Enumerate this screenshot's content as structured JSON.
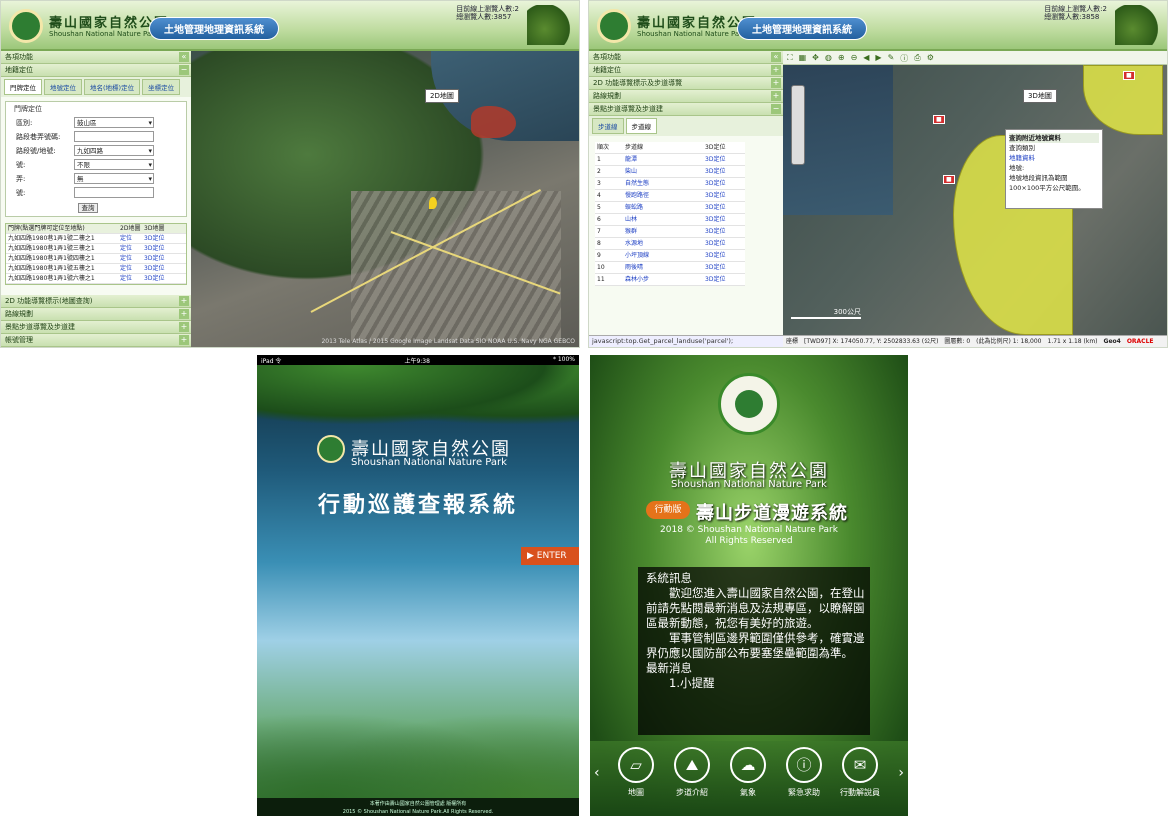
{
  "p1": {
    "header": {
      "title_cn": "壽山國家自然公園",
      "title_en": "Shoushan National Nature Park",
      "system": "土地管理地理資訊系統",
      "stat1": "目前線上瀏覽人數:2",
      "stat2": "總瀏覽人數:3857"
    },
    "sidebar": {
      "top": "各項功能",
      "section1": "地籍定位",
      "tabs": [
        "門牌定位",
        "地號定位",
        "地名(地標)定位",
        "坐標定位"
      ],
      "fieldset": "門牌定位",
      "fields": [
        {
          "label": "區別:",
          "value": "鼓山區"
        },
        {
          "label": "路段巷弄號碼:",
          "value": ""
        },
        {
          "label": "路段號/地號:",
          "value": "九如四路"
        },
        {
          "label": "號:",
          "value": "不限"
        },
        {
          "label": "弄:",
          "value": "無"
        },
        {
          "label": "號:",
          "value": ""
        }
      ],
      "query": "查詢",
      "table_head": [
        "門牌(點選門牌可定位至地點)",
        "2D地圖",
        "3D地圖"
      ],
      "rows": [
        {
          "addr": "九如四路1980巷1弄1號二樓之1",
          "a": "定位",
          "b": "3D定位"
        },
        {
          "addr": "九如四路1980巷1弄1號三樓之1",
          "a": "定位",
          "b": "3D定位"
        },
        {
          "addr": "九如四路1980巷1弄1號四樓之1",
          "a": "定位",
          "b": "3D定位"
        },
        {
          "addr": "九如四路1980巷1弄1號五樓之1",
          "a": "定位",
          "b": "3D定位"
        },
        {
          "addr": "九如四路1980巷1弄1號六樓之1",
          "a": "定位",
          "b": "3D定位"
        }
      ],
      "bottom": [
        "2D 功能導覽標示(地圖查詢)",
        "路線規劃",
        "景點步道導覽及步道建",
        "帳號管理"
      ]
    },
    "map_label": "2D地圖",
    "status": "2013 Tele Atlas / 2015 Google Image Landsat Data SIO NOAA U.S. Navy NGA GEBCO"
  },
  "p2": {
    "header": {
      "title_cn": "壽山國家自然公園",
      "title_en": "Shoushan National Nature Park",
      "system": "土地管理地理資訊系統",
      "stat1": "目前線上瀏覽人數:2",
      "stat2": "總瀏覽人數:3858"
    },
    "sidebar": {
      "top": "各項功能",
      "items": [
        "地籍定位",
        "2D 功能導覽標示及步道導覽",
        "路線規劃",
        "景點步道導覽及步道建"
      ],
      "tabs": [
        "步道線",
        "步道線"
      ],
      "table_head": [
        "順次",
        "步道線",
        "3D定位"
      ],
      "rows": [
        {
          "n": "1",
          "name": "龍潭",
          "loc": "3D定位"
        },
        {
          "n": "2",
          "name": "柴山",
          "loc": "3D定位"
        },
        {
          "n": "3",
          "name": "自然生態",
          "loc": "3D定位"
        },
        {
          "n": "4",
          "name": "慢跑路徑",
          "loc": "3D定位"
        },
        {
          "n": "5",
          "name": "蜈蚣路",
          "loc": "3D定位"
        },
        {
          "n": "6",
          "name": "山林",
          "loc": "3D定位"
        },
        {
          "n": "7",
          "name": "猴群",
          "loc": "3D定位"
        },
        {
          "n": "8",
          "name": "水源地",
          "loc": "3D定位"
        },
        {
          "n": "9",
          "name": "小坪頂線",
          "loc": "3D定位"
        },
        {
          "n": "10",
          "name": "雨後晴",
          "loc": "3D定位"
        },
        {
          "n": "11",
          "name": "森林小步",
          "loc": "3D定位"
        }
      ],
      "js": "javascript:top.Get_parcel_landuse('parcel');"
    },
    "map_label": "3D地圖",
    "popup": {
      "title": "查詢附近地號資料",
      "l1": "查詢類別",
      "l2": "地籍資料",
      "l3": "地號:",
      "l4": "地號地段資訊為範圍",
      "l5": "100×100平方公尺範圍。"
    },
    "scale": "300公尺",
    "footer": {
      "a": "座標",
      "b": "[TWD97] X: 174050.77, Y: 2502833.63 (公尺)",
      "c": "圖層數: 0",
      "d": "(此為比例尺) 1: 18,000",
      "e": "1.71 x 1.18 (km)",
      "f": "Geo4",
      "g": "ORACLE"
    }
  },
  "p3": {
    "status_left": "iPad 令",
    "status_time": "上午9:38",
    "status_right": "* 100%",
    "title_cn": "壽山國家自然公園",
    "title_en": "Shoushan National Nature Park",
    "app": "行動巡護查報系統",
    "enter": "ENTER",
    "foot1": "本著作由壽山國家自然公園管理處 版權所有",
    "foot2": "2015 © Shoushan National Nature Park.All Rights Reserved."
  },
  "p4": {
    "title_cn": "壽山國家自然公園",
    "title_en": "Shoushan National Nature Park",
    "badge": "行動版",
    "app": "壽山步道漫遊系統",
    "copy1": "2018 © Shoushan National Nature Park",
    "copy2": "All Rights Reserved",
    "msg_title": "系統訊息",
    "msg1": "歡迎您進入壽山國家自然公園，在登山前請先點閱最新消息及法規專區，以瞭解園區最新動態，祝您有美好的旅遊。",
    "msg2": "軍事管制區邊界範圍僅供參考，確實邊界仍應以國防部公布要塞堡壘範圍為準。",
    "news": "最新消息",
    "news1": "1.小提醒",
    "icons": [
      {
        "label": "地圖",
        "icon": "map-icon"
      },
      {
        "label": "步道介紹",
        "icon": "trail-icon"
      },
      {
        "label": "氣象",
        "icon": "weather-icon"
      },
      {
        "label": "緊急求助",
        "icon": "info-icon"
      },
      {
        "label": "行動解說員",
        "icon": "chat-icon"
      }
    ]
  }
}
